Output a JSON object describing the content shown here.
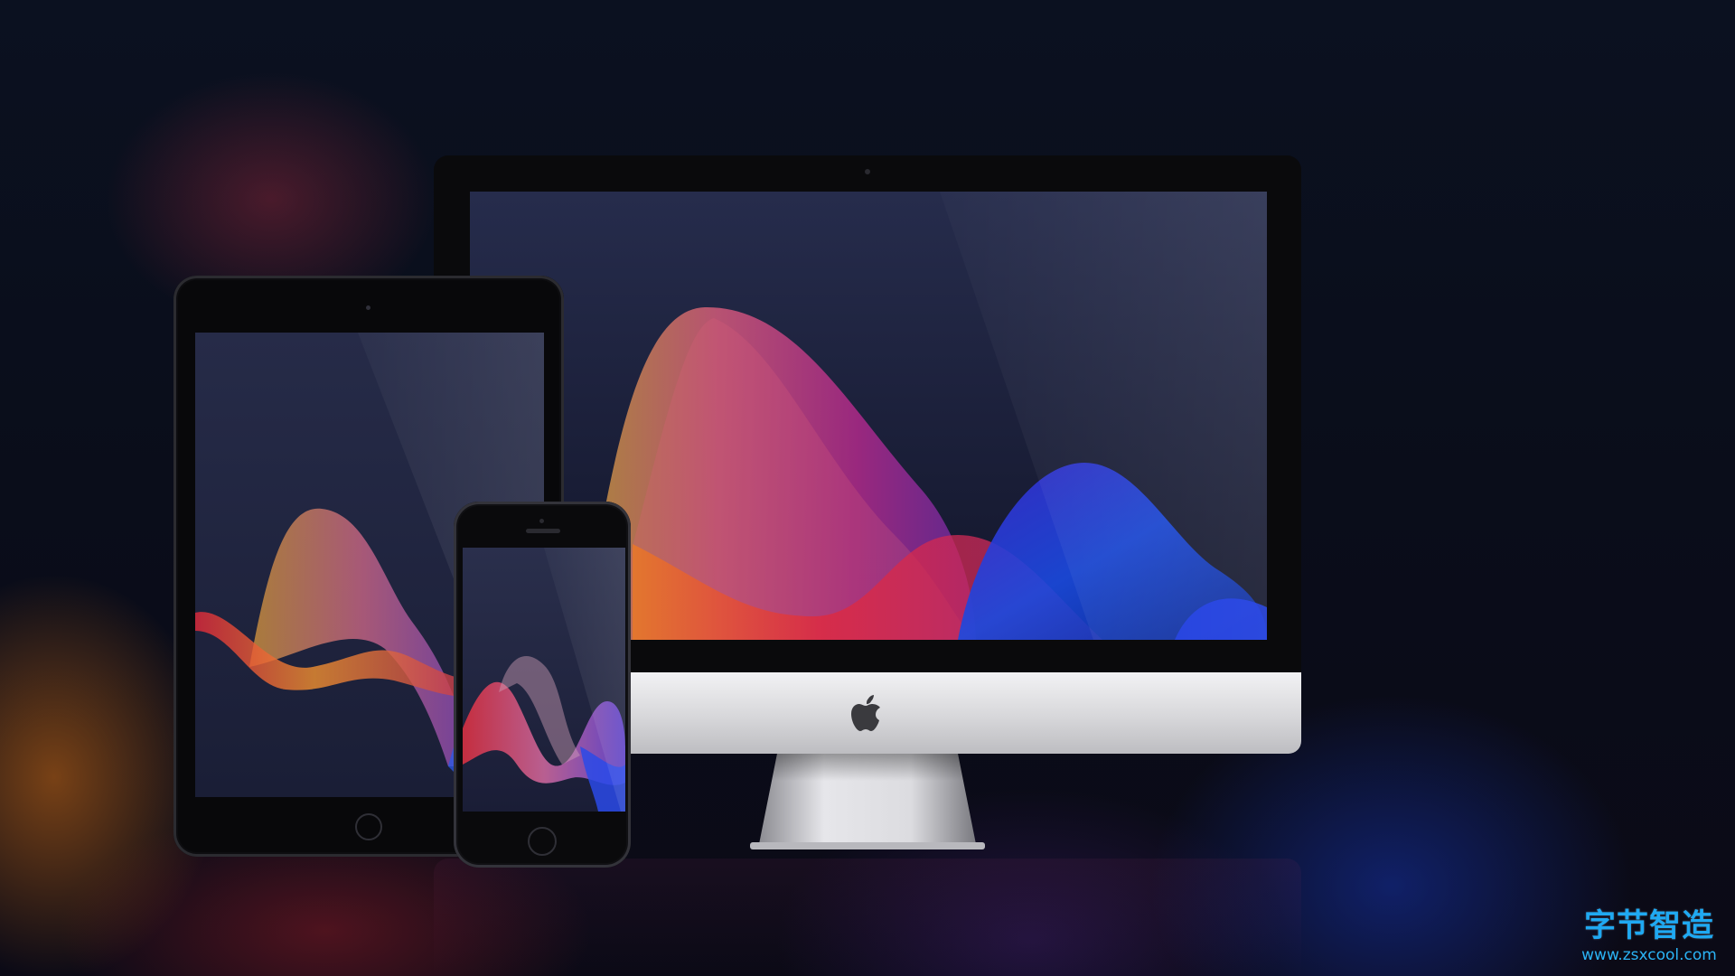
{
  "scene": {
    "description_colors": {
      "background": "#0a0d1a",
      "wave_orange": "#e8a23a",
      "wave_pink": "#d23a8a",
      "wave_red": "#e2283a",
      "wave_blue": "#1e3cd8",
      "screen_bg": "#1f2440"
    },
    "devices": {
      "imac_logo_icon": "apple-logo-icon",
      "ipad_home_icon": "home-button-icon",
      "iphone_home_icon": "home-button-icon"
    }
  },
  "watermark": {
    "brand": "字节智造",
    "url": "www.zsxcool.com",
    "color": "#1fa9f2"
  }
}
